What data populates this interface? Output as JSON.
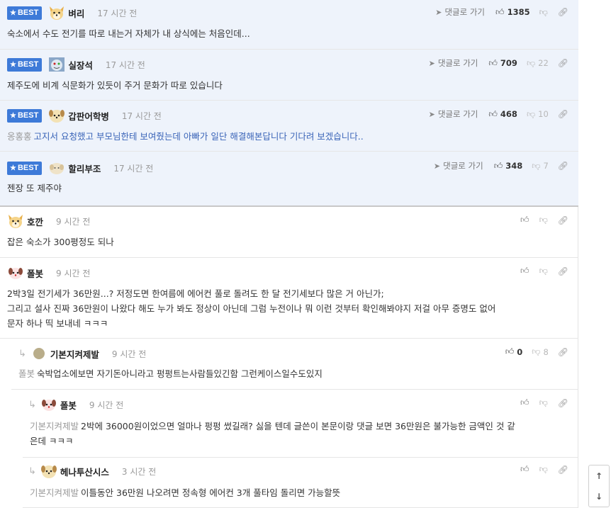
{
  "best_label": "BEST",
  "reply_link_label": "댓글로 가기",
  "comments": [
    {
      "nick": "벼리",
      "time": "17 시간 전",
      "up": "1385",
      "down": "",
      "text": "숙소에서 수도 전기를 따로 내는거 자체가 내 상식에는 처음인데..."
    },
    {
      "nick": "실장석",
      "time": "17 시간 전",
      "up": "709",
      "down": "22",
      "text": "제주도에 비계 식문화가 있듯이 주거 문화가 따로 있습니다"
    },
    {
      "nick": "갑판어학병",
      "time": "17 시간 전",
      "up": "468",
      "down": "10",
      "mention": "옹홍홍",
      "text": "고지서 요청했고 부모님한테 보여줬는데 아빠가 일단 해결해본답니다 기다려 보겠습니다.."
    },
    {
      "nick": "할리부조",
      "time": "17 시간 전",
      "up": "348",
      "down": "7",
      "text": "젠장 또 제주야"
    },
    {
      "nick": "호깐",
      "time": "9 시간 전",
      "text": "잡은 숙소가 300평정도 되나"
    },
    {
      "nick": "폴봇",
      "time": "9 시간 전",
      "text_lines": [
        "2박3일 전기세가 36만원...? 저정도면 한여름에 에어컨 풀로 돌려도 한 달 전기세보다 많은 거 아닌가;",
        "그리고 설사 진짜 36만원이 나왔다 해도 누가 봐도 정상이 아닌데 그럼 누전이나 뭐 이런 것부터 확인해봐야지 저걸 아무 증명도 없어",
        "문자 하나 띡 보내네 ㅋㅋㅋ"
      ]
    },
    {
      "nick": "기본지켜제발",
      "time": "9 시간 전",
      "up": "0",
      "down": "8",
      "mention": "폴봇",
      "text": "숙박업소에보면 자기돈아니라고 펑펑트는사람들있긴함 그런케이스일수도있지"
    },
    {
      "nick": "폴봇",
      "time": "9 시간 전",
      "mention": "기본지켜제발",
      "text_lines": [
        "2박에 36000원이었으면 얼마나 펑펑 썼길래? 싫을 텐데 글쓴이 본문이랑 댓글 보면 36만원은 불가능한 금액인 것 같",
        "은데 ㅋㅋㅋ"
      ]
    },
    {
      "nick": "헤나투산시스",
      "time": "3 시간 전",
      "mention": "기본지켜제발",
      "text": "이틀동안 36만원 나오려면 정속형 에어컨 3개 풀타임 돌리면 가능할뜻"
    }
  ],
  "icons": {
    "like": "thumb-up-icon",
    "dislike": "thumb-down-icon",
    "link": "link-icon",
    "reply_arrow": "reply-arrow-icon",
    "star": "star-icon",
    "scroll_up": "arrow-up-icon",
    "scroll_down": "arrow-down-icon"
  },
  "colors": {
    "best_bg": "#eef3fb",
    "badge": "#3d7ad8",
    "mention_blue": "#3a64b8"
  }
}
